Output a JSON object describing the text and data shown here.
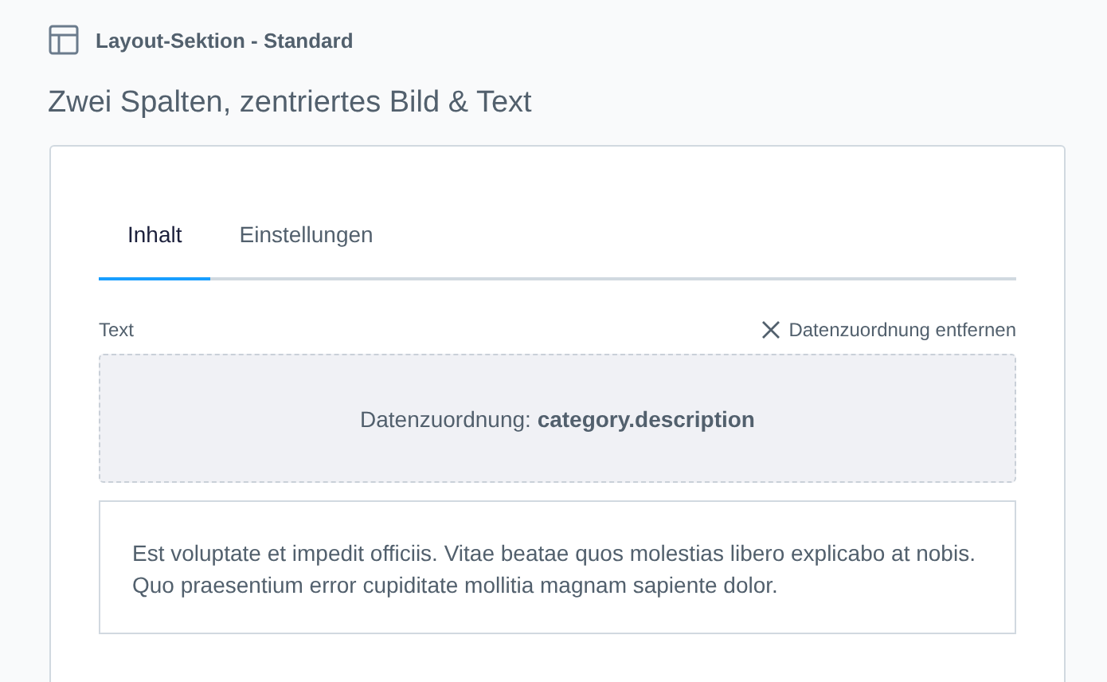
{
  "section": {
    "type_label": "Layout-Sektion - Standard",
    "title": "Zwei Spalten, zentriertes Bild & Text"
  },
  "tabs": [
    {
      "label": "Inhalt",
      "selected": true
    },
    {
      "label": "Einstellungen",
      "selected": false
    }
  ],
  "field": {
    "label": "Text",
    "remove_action": "Datenzuordnung entfernen",
    "mapping": "Datenzuordnung: **category.description**",
    "preview": "Est voluptate et impedit officiis. Vitae beatae quos molestias libero explicabo at nobis. Quo praesentium error cupiditate mollitia magnam sapiente dolor."
  }
}
